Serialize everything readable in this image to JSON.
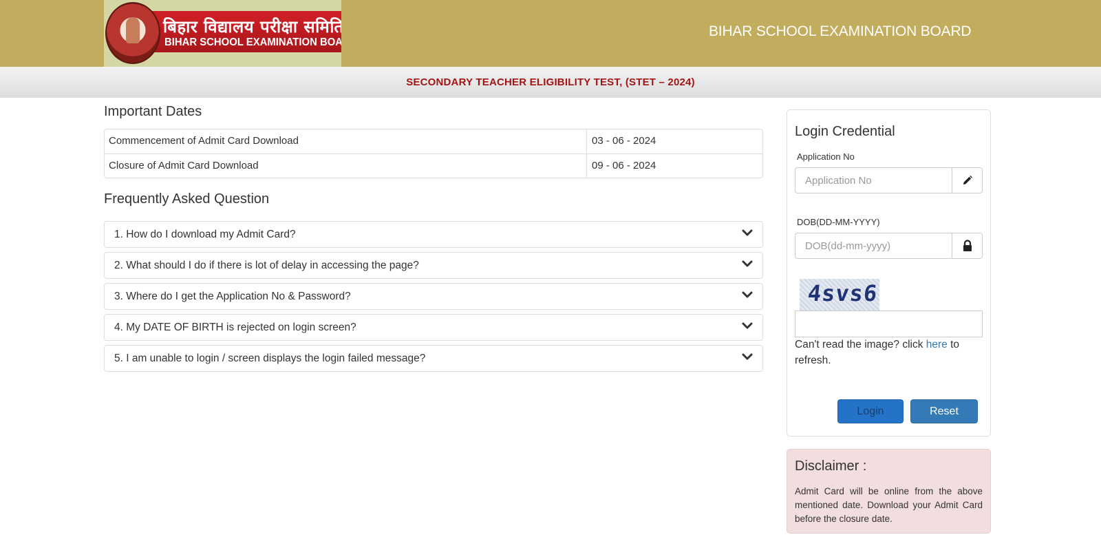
{
  "header": {
    "logo_hindi": "बिहार विद्यालय परीक्षा समिति",
    "logo_english": "BIHAR SCHOOL EXAMINATION BOARD",
    "title": "BIHAR SCHOOL EXAMINATION BOARD",
    "brand_color": "#c2ac5d"
  },
  "exam_title": "SECONDARY TEACHER ELIGIBILITY TEST, (STET – 2024)",
  "important_dates": {
    "heading": "Important Dates",
    "rows": [
      {
        "label": "Commencement of Admit Card Download",
        "value": "03 - 06 - 2024"
      },
      {
        "label": "Closure of Admit Card Download",
        "value": "09 - 06 - 2024"
      }
    ]
  },
  "faq": {
    "heading": "Frequently Asked Question",
    "items": [
      {
        "question": "1. How do I download my Admit Card?",
        "icon": "chevron-down-icon"
      },
      {
        "question": "2. What should I do if there is lot of delay in accessing the page?",
        "icon": "chevron-down-icon"
      },
      {
        "question": "3. Where do I get the Application No & Password?",
        "icon": "chevron-down-icon"
      },
      {
        "question": "4. My DATE OF BIRTH is rejected on login screen?",
        "icon": "chevron-down-icon"
      },
      {
        "question": "5. I am unable to login / screen displays the login failed message?",
        "icon": "chevron-down-icon"
      }
    ]
  },
  "login": {
    "title": "Login Credential",
    "application_label": "Application No",
    "application_placeholder": "Application No",
    "application_icon": "pencil-icon",
    "dob_label": "DOB(DD-MM-YYYY)",
    "dob_placeholder": "DOB(dd-mm-yyyy)",
    "dob_icon": "lock-icon",
    "captcha_text": "4svs6",
    "captcha_value": "",
    "refresh_prefix": "Can't read the image? click ",
    "refresh_link": "here",
    "refresh_suffix": " to refresh.",
    "login_button": "Login",
    "reset_button": "Reset",
    "button_color": "#337ab7"
  },
  "disclaimer": {
    "title": "Disclaimer :",
    "text": "Admit Card will be online from the above mentioned date. Download your Admit Card before the closure date.",
    "bg_color": "#f2dede"
  }
}
